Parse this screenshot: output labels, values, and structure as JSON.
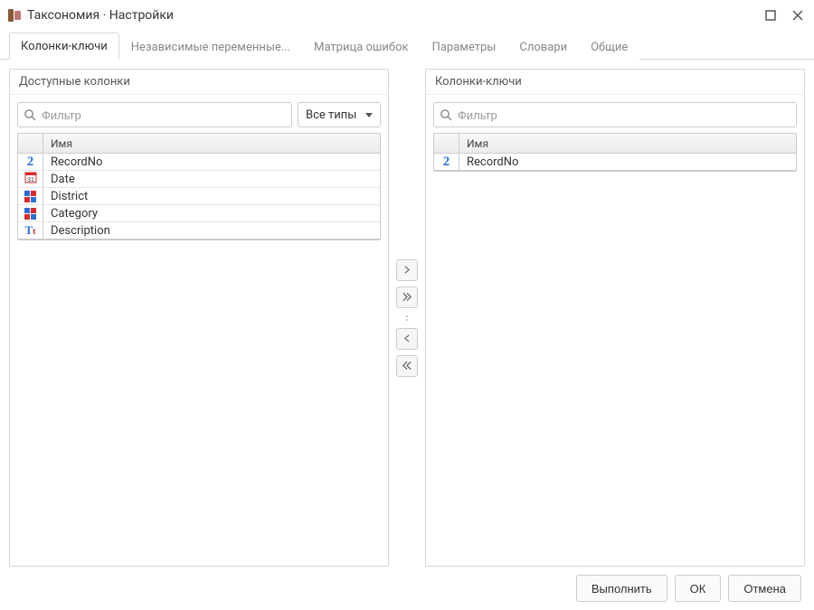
{
  "window": {
    "title": "Таксономия · Настройки"
  },
  "tabs": [
    {
      "label": "Колонки-ключи",
      "active": true
    },
    {
      "label": "Независимые переменные...",
      "active": false
    },
    {
      "label": "Матрица ошибок",
      "active": false
    },
    {
      "label": "Параметры",
      "active": false
    },
    {
      "label": "Словари",
      "active": false
    },
    {
      "label": "Общие",
      "active": false
    }
  ],
  "leftPanel": {
    "title": "Доступные колонки",
    "filterPlaceholder": "Фильтр",
    "typeSelectLabel": "Все типы",
    "columnHeader": "Имя",
    "rows": [
      {
        "icon": "number",
        "name": "RecordNo"
      },
      {
        "icon": "date",
        "name": "Date"
      },
      {
        "icon": "category",
        "name": "District"
      },
      {
        "icon": "category",
        "name": "Category"
      },
      {
        "icon": "text",
        "name": "Description"
      }
    ]
  },
  "rightPanel": {
    "title": "Колонки-ключи",
    "filterPlaceholder": "Фильтр",
    "columnHeader": "Имя",
    "rows": [
      {
        "icon": "number",
        "name": "RecordNo"
      }
    ]
  },
  "footer": {
    "execute": "Выполнить",
    "ok": "ОК",
    "cancel": "Отмена"
  }
}
